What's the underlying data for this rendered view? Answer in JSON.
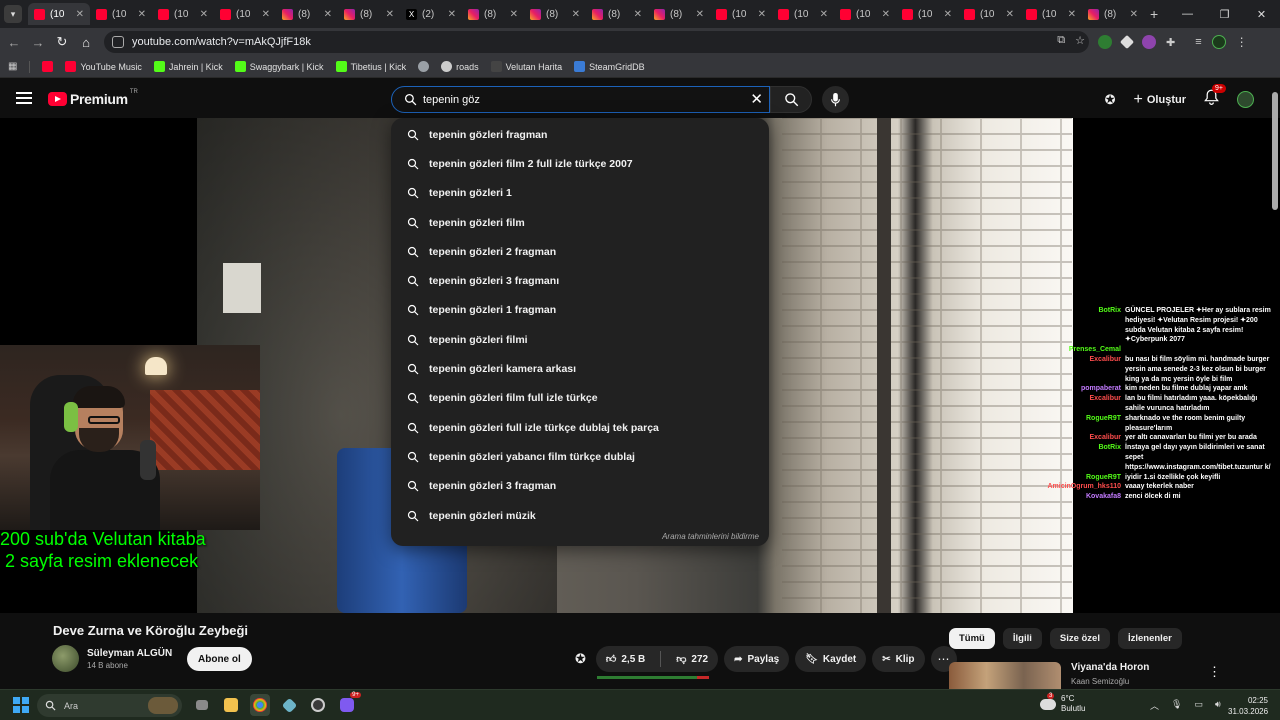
{
  "browser": {
    "tabs": [
      {
        "favicon": "youtube",
        "label": "(10",
        "active": true
      },
      {
        "favicon": "youtube",
        "label": "(10",
        "active": false
      },
      {
        "favicon": "youtube",
        "label": "(10",
        "active": false
      },
      {
        "favicon": "youtube",
        "label": "(10",
        "active": false
      },
      {
        "favicon": "instagram",
        "label": "(8)",
        "active": false
      },
      {
        "favicon": "instagram",
        "label": "(8)",
        "active": false
      },
      {
        "favicon": "x",
        "label": "(2)",
        "active": false
      },
      {
        "favicon": "instagram",
        "label": "(8)",
        "active": false
      },
      {
        "favicon": "instagram",
        "label": "(8)",
        "active": false
      },
      {
        "favicon": "instagram",
        "label": "(8)",
        "active": false
      },
      {
        "favicon": "instagram",
        "label": "(8)",
        "active": false
      },
      {
        "favicon": "youtube",
        "label": "(10",
        "active": false
      },
      {
        "favicon": "youtube",
        "label": "(10",
        "active": false
      },
      {
        "favicon": "youtube",
        "label": "(10",
        "active": false
      },
      {
        "favicon": "youtube",
        "label": "(10",
        "active": false
      },
      {
        "favicon": "youtube",
        "label": "(10",
        "active": false
      },
      {
        "favicon": "youtube",
        "label": "(10",
        "active": false
      },
      {
        "favicon": "instagram",
        "label": "(8)",
        "active": false
      }
    ],
    "new_tab_label": "+",
    "url": "youtube.com/watch?v=mAkQJjfF18k",
    "bookmarks": [
      {
        "icon": "youtube-music",
        "color": "#ff0033",
        "label": "YouTube Music"
      },
      {
        "icon": "kick",
        "color": "#53fc18",
        "label": "Jahrein | Kick"
      },
      {
        "icon": "kick",
        "color": "#53fc18",
        "label": "Swaggybark | Kick"
      },
      {
        "icon": "kick",
        "color": "#53fc18",
        "label": "Tibetius | Kick"
      },
      {
        "icon": "globe",
        "color": "#9aa0a6",
        "label": ""
      },
      {
        "icon": "roads",
        "color": "#cccccc",
        "label": "roads"
      },
      {
        "icon": "velutan",
        "color": "#444444",
        "label": "Velutan Harita"
      },
      {
        "icon": "steamgriddb",
        "color": "#3a7bd5",
        "label": "SteamGridDB"
      }
    ]
  },
  "youtube": {
    "brand": "Premium",
    "country": "TR",
    "search_value": "tepenin göz",
    "create_label": "Oluştur",
    "notif_count": "9+",
    "suggestions": [
      "tepenin gözleri fragman",
      "tepenin gözleri film 2 full izle türkçe 2007",
      "tepenin gözleri 1",
      "tepenin gözleri film",
      "tepenin gözleri 2 fragman",
      "tepenin gözleri 3 fragmanı",
      "tepenin gözleri 1 fragman",
      "tepenin gözleri filmi",
      "tepenin gözleri kamera arkası",
      "tepenin gözleri film full izle türkçe",
      "tepenin gözleri full izle türkçe dublaj tek parça",
      "tepenin gözleri yabancı film türkçe dublaj",
      "tepenin gözleri 3 fragman",
      "tepenin gözleri müzik"
    ],
    "suggest_footer": "Arama tahminlerini bildirme",
    "overlay_text": [
      "200 sub'da Velutan kitaba",
      "2 sayfa resim eklenecek"
    ],
    "chat": [
      {
        "user": "BotRix",
        "color": "#53fc18",
        "text": "GÜNCEL PROJELER ✦Her ay sublara resim hediyesi! ✦Velutan Resim projesi! ✦200 subda Velutan kitaba 2 sayfa resim! ✦Cyberpunk 2077"
      },
      {
        "user": "Prenses_Cemal",
        "color": "#53fc18",
        "text": ""
      },
      {
        "user": "Excalibur",
        "color": "#ff4d4d",
        "text": "bu nası bi film söylim mi. handmade burger yersin ama senede 2-3 kez olsun bi burger king ya da mc yersin öyle bi film"
      },
      {
        "user": "pompaberat",
        "color": "#c37bff",
        "text": "kim neden bu filme dublaj yapar amk"
      },
      {
        "user": "Excalibur",
        "color": "#ff4d4d",
        "text": "lan bu filmi hatırladım yaaa. köpekbalığı sahile vurunca hatırladım"
      },
      {
        "user": "RogueR9T",
        "color": "#53fc18",
        "text": "sharknado ve the room benim guilty pleasure'larım"
      },
      {
        "user": "Excalibur",
        "color": "#ff4d4d",
        "text": "yer altı canavarları bu filmi yer bu arada"
      },
      {
        "user": "BotRix",
        "color": "#53fc18",
        "text": "İnstaya gel dayı yayın bildirimleri ve sanat sepet https://www.instagram.com/tibet.tuzuntur k/"
      },
      {
        "user": "RogueR9T",
        "color": "#53fc18",
        "text": "iyidir 1.si özellikle çok keyifli"
      },
      {
        "user": "AmicinOgrum_hks110",
        "color": "#ff4d4d",
        "text": "vaaay tekerlek naber"
      },
      {
        "user": "Kovakafa8",
        "color": "#c37bff",
        "text": "zenci ölcek di mi"
      }
    ],
    "video_title": "Deve Zurna ve Köroğlu Zeybeği",
    "channel_name": "Süleyman ALGÜN",
    "channel_subs": "14 B abone",
    "subscribe_label": "Abone ol",
    "likes": "2,5 B",
    "dislikes": "272",
    "like_ratio": 0.9,
    "share_label": "Paylaş",
    "save_label": "Kaydet",
    "clip_label": "Klip",
    "chips": [
      "Tümü",
      "İlgili",
      "Size özel",
      "İzlenenler"
    ],
    "rec_title": "Viyana'da Horon",
    "rec_channel": "Kaan Semizoğlu"
  },
  "taskbar": {
    "search_placeholder": "Ara",
    "weather_badge": "3",
    "weather_temp": "6°C",
    "weather_desc": "Bulutlu",
    "discord_badge": "9+",
    "time": "02:25",
    "date": "31.03.2026"
  }
}
